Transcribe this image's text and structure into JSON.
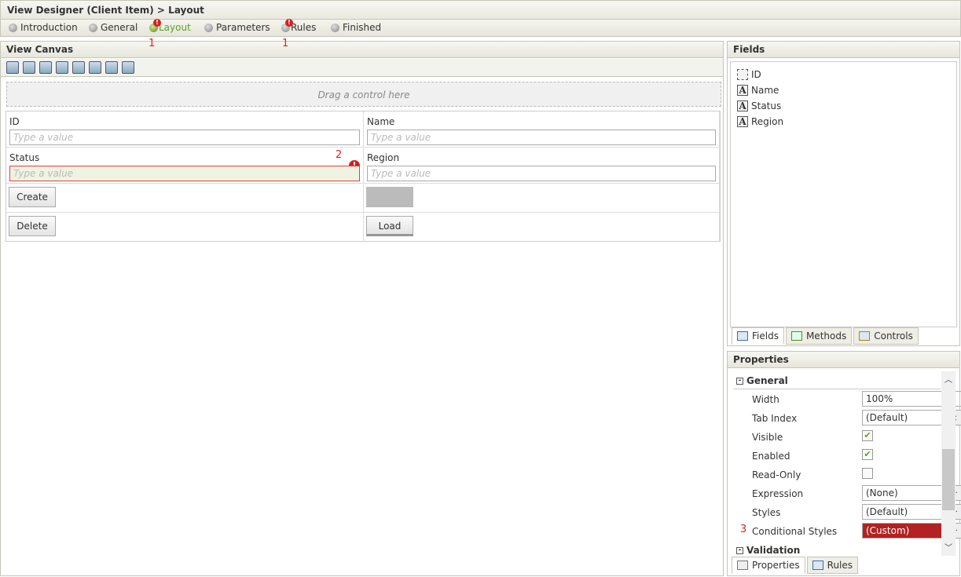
{
  "title": "View Designer (Client Item) > Layout",
  "steps": [
    {
      "label": "Introduction"
    },
    {
      "label": "General"
    },
    {
      "label": "Layout",
      "active": true,
      "error": true,
      "marker": "1"
    },
    {
      "label": "Parameters"
    },
    {
      "label": "Rules",
      "error": true,
      "marker": "1"
    },
    {
      "label": "Finished"
    }
  ],
  "canvas": {
    "title": "View Canvas",
    "drop_hint": "Drag a control here",
    "toolbar": [
      "wizard-icon",
      "add-table-icon",
      "edit-icon",
      "columns-icon",
      "resize-icon",
      "transfer-icon",
      "sum-icon",
      "notes-icon"
    ],
    "fields": {
      "id_label": "ID",
      "name_label": "Name",
      "status_label": "Status",
      "region_label": "Region",
      "placeholder": "Type a value",
      "status_marker": "2"
    },
    "buttons": {
      "create": "Create",
      "delete": "Delete",
      "load": "Load"
    }
  },
  "fields_panel": {
    "title": "Fields",
    "items": [
      "ID",
      "Name",
      "Status",
      "Region"
    ],
    "tabs": [
      "Fields",
      "Methods",
      "Controls"
    ]
  },
  "properties": {
    "title": "Properties",
    "general": "General",
    "validation": "Validation",
    "rows": {
      "width_label": "Width",
      "width": "100%",
      "tab_label": "Tab Index",
      "tab": "(Default)",
      "visible_label": "Visible",
      "enabled_label": "Enabled",
      "readonly_label": "Read-Only",
      "expression_label": "Expression",
      "expression": "(None)",
      "styles_label": "Styles",
      "styles": "(Default)",
      "cond_label": "Conditional Styles",
      "cond": "(Custom)",
      "cond_marker": "3"
    },
    "visible": true,
    "enabled": true,
    "readonly": false,
    "tabs": [
      "Properties",
      "Rules"
    ],
    "ellipsis": "..."
  },
  "colors": {
    "accent_green": "#5aa02c",
    "error_red": "#d42020",
    "custom_bg": "#b22222"
  }
}
